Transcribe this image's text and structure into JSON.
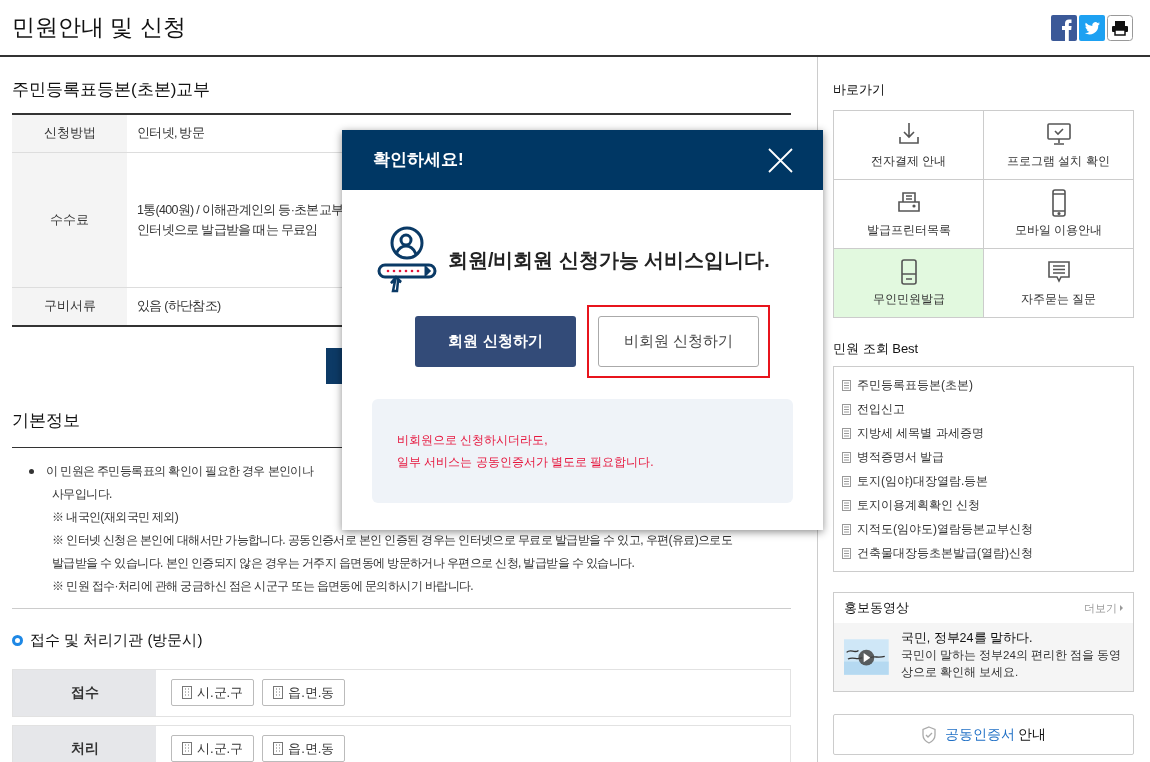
{
  "page_title": "민원안내 및 신청",
  "share_buttons": [
    {
      "kind": "facebook"
    },
    {
      "kind": "twitter"
    },
    {
      "kind": "print"
    }
  ],
  "service": {
    "title": "주민등록표등본(초본)교부",
    "rows": [
      {
        "label": "신청방법",
        "lines": [
          "인터넷, 방문"
        ]
      },
      {
        "label": "수수료",
        "lines": [
          "1통(400원) / 이해관계인의 등·초본교부",
          "인터넷으로 발급받을 때는 무료임"
        ]
      },
      {
        "label": "구비서류",
        "lines": [
          "있음 (하단참조)"
        ]
      }
    ]
  },
  "basic_info": {
    "title": "기본정보",
    "bullet": "이 민원은 주민등록표의 확인이 필요한 경우 본인이나",
    "lines": [
      "사무입니다.",
      "※ 내국인(재외국민 제외)",
      "※ 인터넷 신청은 본인에 대해서만 가능합니다. 공동인증서로 본인 인증된 경우는 인터넷으로 무료로 발급받을 수 있고, 우편(유료)으로도",
      "발급받을 수 있습니다. 본인 인증되지 않은 경우는 거주지 읍면동에 방문하거나 우편으로 신청, 발급받을 수 있습니다.",
      "※ 민원 접수·처리에 관해 궁금하신 점은 시군구 또는 읍면동에 문의하시기 바랍니다."
    ]
  },
  "agencies": {
    "title": "접수 및 처리기관 (방문시)",
    "rows": [
      {
        "label": "접수",
        "offices": [
          "시.군.구",
          "읍.면.동"
        ]
      },
      {
        "label": "처리",
        "offices": [
          "시.군.구",
          "읍.면.동"
        ]
      }
    ]
  },
  "shortcuts": {
    "title": "바로가기",
    "items": [
      {
        "kind": "download",
        "label": "전자결제 안내",
        "selected": false
      },
      {
        "kind": "monitor",
        "label": "프로그램 설치 확인",
        "selected": false
      },
      {
        "kind": "printer",
        "label": "발급프린터목록",
        "selected": false
      },
      {
        "kind": "mobile",
        "label": "모바일 이용안내",
        "selected": false
      },
      {
        "kind": "kiosk",
        "label": "무인민원발급",
        "selected": true
      },
      {
        "kind": "chat",
        "label": "자주묻는 질문",
        "selected": false
      }
    ]
  },
  "best": {
    "title": "민원 조회 Best",
    "items": [
      "주민등록표등본(초본)",
      "전입신고",
      "지방세 세목별 과세증명",
      "병적증명서 발급",
      "토지(임야)대장열람.등본",
      "토지이용계획확인 신청",
      "지적도(임야도)열람등본교부신청",
      "건축물대장등초본발급(열람)신청"
    ]
  },
  "video": {
    "title": "홍보동영상",
    "more": "더보기",
    "headline": "국민, 정부24를 말하다.",
    "description": "국민이 말하는 정부24의 편리한 점을 동영상으로 확인해 보세요."
  },
  "cert_button": {
    "highlight": "공동인증서",
    "rest": "안내"
  },
  "modal": {
    "title": "확인하세요!",
    "message": "회원/비회원 신청가능 서비스입니다.",
    "buttons": [
      {
        "label": "회원 신청하기",
        "kind": "primary",
        "highlighted": false
      },
      {
        "label": "비회원 신청하기",
        "kind": "secondary",
        "highlighted": true
      }
    ],
    "notice": [
      "비회원으로 신청하시더라도,",
      "일부 서비스는 공동인증서가 별도로 필요합니다."
    ]
  }
}
